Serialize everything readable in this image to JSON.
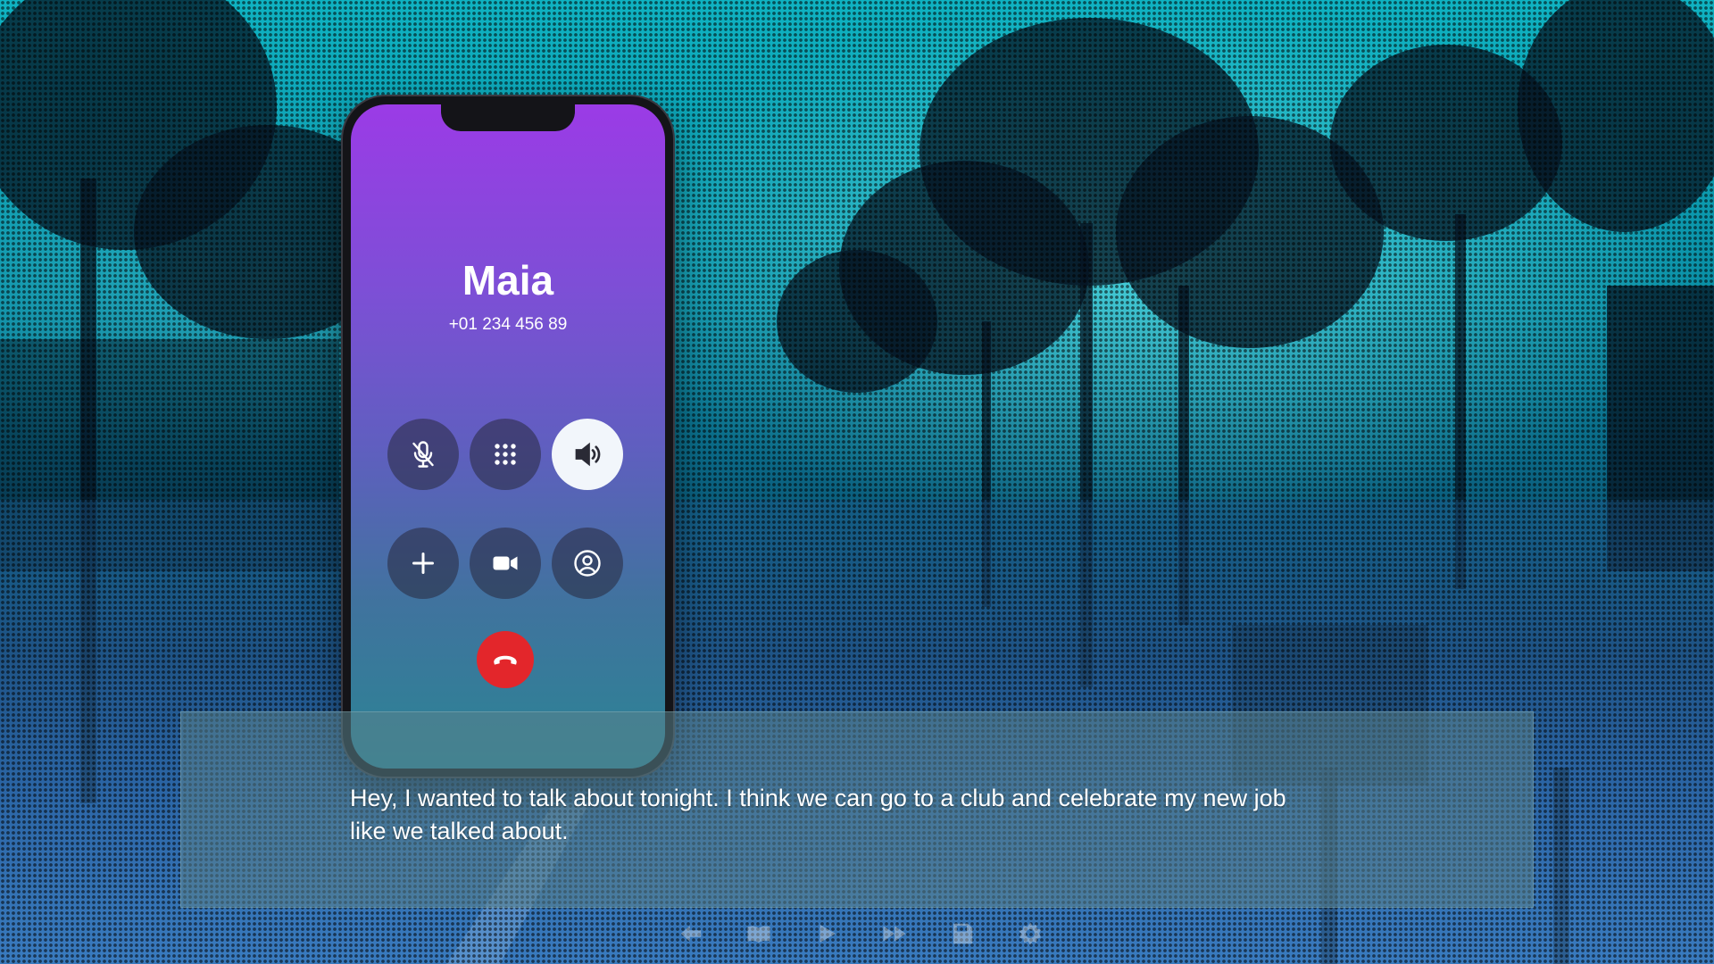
{
  "call": {
    "caller_name": "Maia",
    "caller_number": "+01 234 456 89",
    "buttons": [
      {
        "icon": "mic-off-icon",
        "active": false
      },
      {
        "icon": "keypad-icon",
        "active": false
      },
      {
        "icon": "speaker-icon",
        "active": true
      },
      {
        "icon": "add-call-icon",
        "active": false
      },
      {
        "icon": "video-icon",
        "active": false
      },
      {
        "icon": "contact-icon",
        "active": false
      }
    ],
    "end_button_icon": "hang-up-icon",
    "end_button_color": "#e3262b"
  },
  "dialogue": {
    "text": "Hey, I wanted to talk about tonight. I think we can go to a club and celebrate my new job like we talked about."
  },
  "quick_menu": {
    "icons": [
      "back-icon",
      "history-icon",
      "auto-icon",
      "skip-icon",
      "save-icon",
      "settings-icon"
    ]
  },
  "colors": {
    "phone_gradient_top": "#9b3be6",
    "phone_gradient_bottom": "#2b8494",
    "background_accent": "#0fb3c2"
  }
}
